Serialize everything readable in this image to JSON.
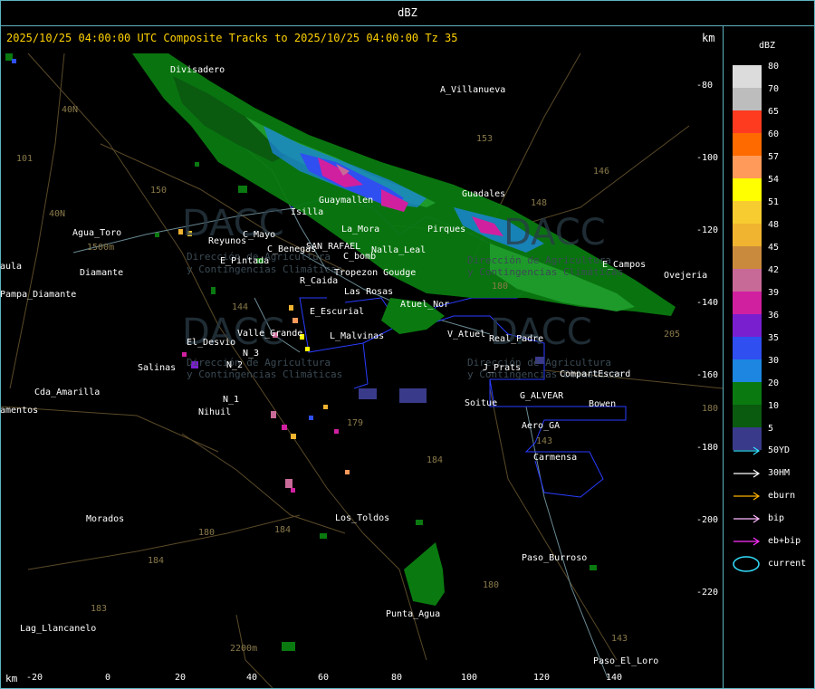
{
  "window_title": "dBZ",
  "subtitle": "2025/10/25 04:00:00 UTC Composite Tracks to 2025/10/25 04:00:00 Tz 35",
  "units": {
    "top": "km",
    "bottom": "km"
  },
  "y_axis_ticks": [
    "-80",
    "-100",
    "-120",
    "-140",
    "-160",
    "-180",
    "-200",
    "-220"
  ],
  "x_axis_ticks": [
    "-20",
    "0",
    "20",
    "40",
    "60",
    "80",
    "100",
    "120",
    "140"
  ],
  "places": [
    "Divisadero",
    "A_Villanueva",
    "Guadales",
    "Isilla",
    "La_Mora",
    "SAN_RAFAEL",
    "C_Benegas",
    "C_Mayo",
    "Reyunos",
    "E_Pintada",
    "C_bomb",
    "Tropezon Goudge",
    "R_Caida",
    "Las Rosas",
    "Atuel_Nor",
    "E_Escurial",
    "Valle_Grande",
    "L_Malvinas",
    "V_Atuel",
    "El_Desvio",
    "Salinas",
    "N_2",
    "N_3",
    "N_1",
    "Nihuil",
    "Agua_Toro",
    "Diamante",
    "Pampa_Diamante",
    "Cda_Amarilla",
    "Soitue",
    "G_ALVEAR",
    "Bowen",
    "CompartEscard",
    "J_Prats",
    "Aero_GA",
    "Carmensa",
    "Los_Toldos",
    "Morados",
    "Paso_Burroso",
    "Punta_Agua",
    "Lag_Llancanelo",
    "Paso_El_Loro",
    "Real_Padre",
    "E_Campos",
    "Ovejeria",
    "Nalla_Leal",
    "Pirques",
    "Guaymallen",
    "aula",
    "amentos"
  ],
  "route_labels": [
    "153",
    "146",
    "148",
    "101",
    "40N",
    "40N",
    "150",
    "144",
    "179",
    "184",
    "180",
    "184",
    "184",
    "183",
    "180",
    "143",
    "143",
    "205",
    "180",
    "180",
    "1500m",
    "2200m"
  ],
  "watermark": {
    "brand": "DACC",
    "line1": "Dirección de Agricultura",
    "line2": "y Contingencias Climáticas"
  },
  "legend": {
    "title": "dBZ",
    "colorbar": [
      {
        "value": "80",
        "color": "#dcdcdc"
      },
      {
        "value": "70",
        "color": "#bdbdbd"
      },
      {
        "value": "65",
        "color": "#ff3b1f"
      },
      {
        "value": "60",
        "color": "#ff6a00"
      },
      {
        "value": "57",
        "color": "#ff9a5a"
      },
      {
        "value": "54",
        "color": "#ffff00"
      },
      {
        "value": "51",
        "color": "#f7cc30"
      },
      {
        "value": "48",
        "color": "#f0b430"
      },
      {
        "value": "45",
        "color": "#c98a3e"
      },
      {
        "value": "42",
        "color": "#c86a98"
      },
      {
        "value": "39",
        "color": "#d020a0"
      },
      {
        "value": "36",
        "color": "#7a1fd0"
      },
      {
        "value": "35",
        "color": "#2f4ff0"
      },
      {
        "value": "30",
        "color": "#1c86e0"
      },
      {
        "value": "20",
        "color": "#0a7a10"
      },
      {
        "value": "10",
        "color": "#0a5a10"
      },
      {
        "value": "5",
        "color": "#3a3a8a"
      }
    ],
    "tracks": [
      {
        "label": "50YD",
        "color": "#33e0ff"
      },
      {
        "label": "30HM",
        "color": "#ffffff"
      },
      {
        "label": "eburn",
        "color": "#ffb000"
      },
      {
        "label": "bip",
        "color": "#ffb8ff"
      },
      {
        "label": "eb+bip",
        "color": "#ff30ff"
      },
      {
        "label": "current",
        "color": "#33e0ff"
      }
    ]
  }
}
